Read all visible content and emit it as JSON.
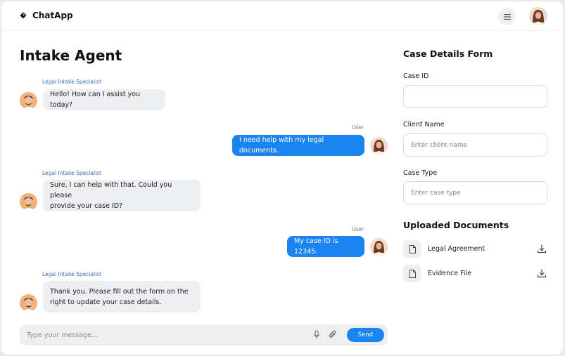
{
  "app": {
    "name": "ChatApp"
  },
  "header": {
    "menu_icon": "hamburger-icon",
    "avatar": "user-avatar"
  },
  "page": {
    "title": "Intake Agent"
  },
  "chat": {
    "messages": [
      {
        "sender": "Legal Intake Specialist",
        "role": "agent",
        "text": "Hello! How can I assist you today?"
      },
      {
        "sender": "User",
        "role": "user",
        "text": "I need help with my legal documents."
      },
      {
        "sender": "Legal Intake Specialist",
        "role": "agent",
        "line1": "Sure, I can help with that. Could you please",
        "line2": "provide your case ID?"
      },
      {
        "sender": "User",
        "role": "user",
        "text": "My case ID is 12345."
      },
      {
        "sender": "Legal Intake Specialist",
        "role": "agent",
        "line1": "Thank you. Please fill out the form on the",
        "line2": "right to update your case details."
      }
    ],
    "composer": {
      "placeholder": "Type your message...",
      "send_label": "Send"
    }
  },
  "form": {
    "title": "Case Details Form",
    "fields": [
      {
        "label": "Case ID",
        "value": "",
        "placeholder": ""
      },
      {
        "label": "Client Name",
        "value": "",
        "placeholder": "Enter client name"
      },
      {
        "label": "Case Type",
        "value": "",
        "placeholder": "Enter case type"
      }
    ]
  },
  "documents": {
    "title": "Uploaded Documents",
    "items": [
      {
        "name": "Legal Agreement"
      },
      {
        "name": "Evidence File"
      }
    ]
  },
  "colors": {
    "accent": "#1a85f0",
    "agent_bubble": "#eeeff1",
    "sender_label": "#3a6dbf"
  }
}
